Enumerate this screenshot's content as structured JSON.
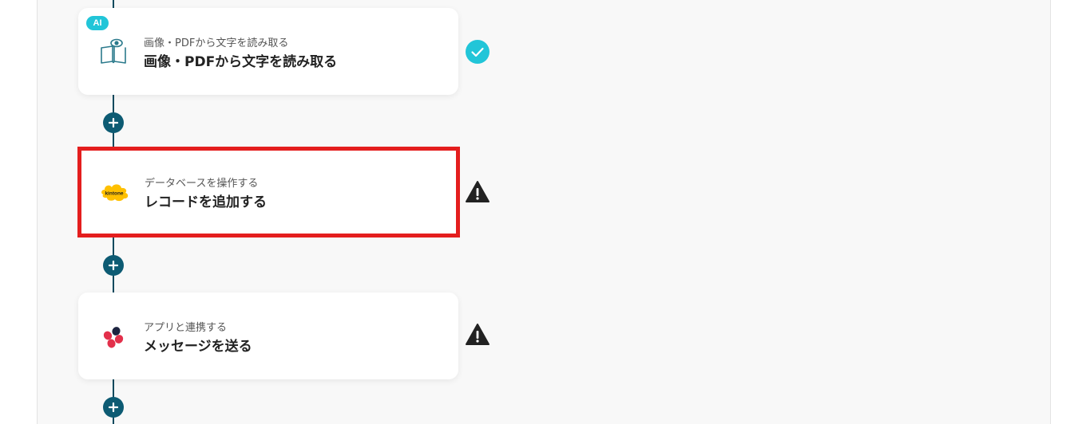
{
  "flow": {
    "steps": [
      {
        "badge": "AI",
        "icon": "ocr-book-eye-icon",
        "subtitle": "画像・PDFから文字を読み取る",
        "title": "画像・PDFから文字を読み取る",
        "status": "check-icon",
        "highlighted": false
      },
      {
        "icon": "kintone-icon",
        "icon_label": "kintone",
        "subtitle": "データベースを操作する",
        "title": "レコードを追加する",
        "status": "warning-icon",
        "highlighted": true
      },
      {
        "icon": "chatwork-icon",
        "subtitle": "アプリと連携する",
        "title": "メッセージを送る",
        "status": "warning-icon",
        "highlighted": false
      }
    ],
    "add_buttons": [
      "add-step-icon",
      "add-step-icon",
      "add-step-icon"
    ]
  },
  "colors": {
    "line": "#0c4a5e",
    "add_button": "#0d5b73",
    "ai_badge": "#21c5d8",
    "check": "#21c5d8",
    "highlight_border": "#e41e1e",
    "kintone": "#ffc000",
    "chatwork_red": "#e3304b",
    "chatwork_navy": "#1d2440"
  }
}
